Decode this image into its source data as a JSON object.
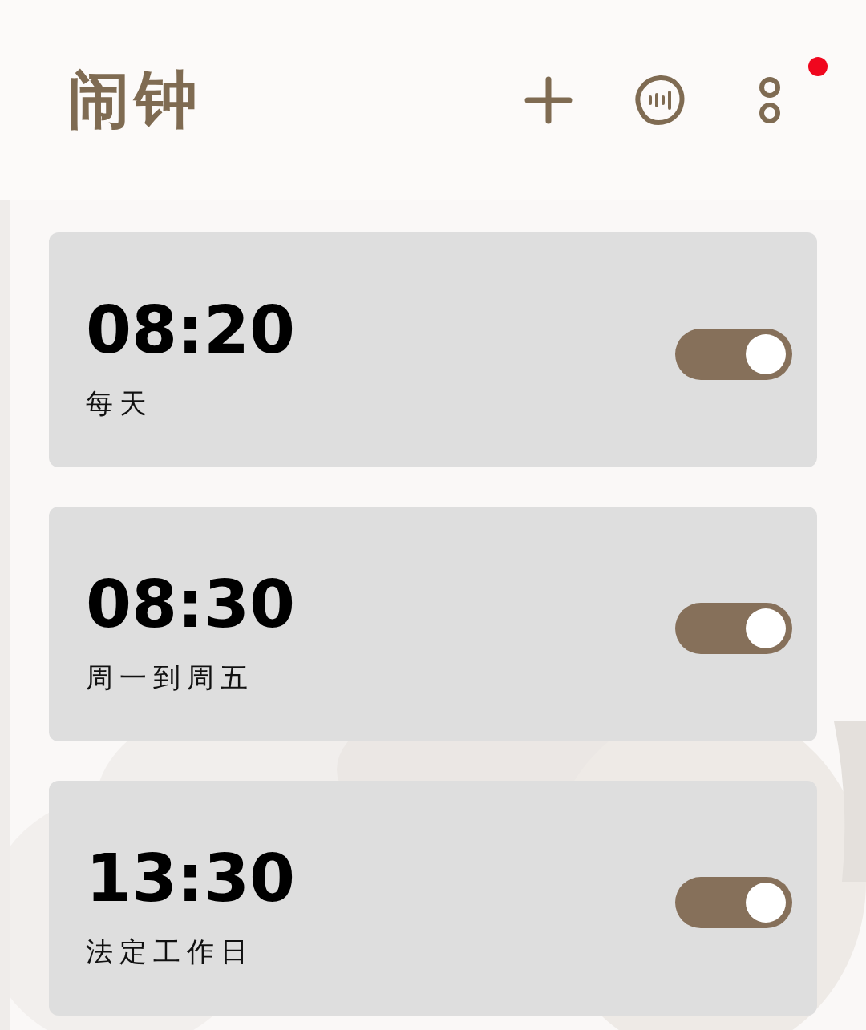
{
  "header": {
    "title": "闹钟",
    "notification_dot": true
  },
  "alarms": [
    {
      "time": "08:20",
      "repeat": "每天",
      "on": true
    },
    {
      "time": "08:30",
      "repeat": "周一到周五",
      "on": true
    },
    {
      "time": "13:30",
      "repeat": "法定工作日",
      "on": true
    }
  ]
}
